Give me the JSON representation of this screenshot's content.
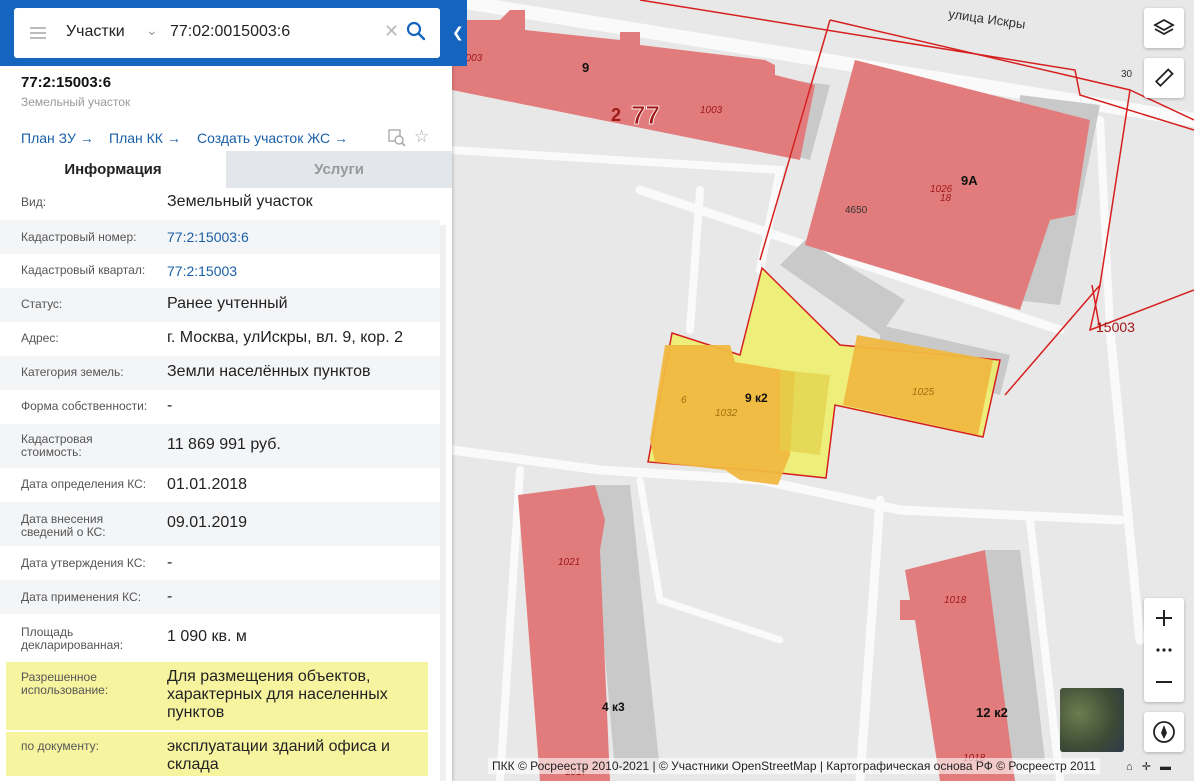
{
  "search": {
    "type_label": "Участки",
    "query": "77:02:0015003:6"
  },
  "object": {
    "id": "77:2:15003:6",
    "type": "Земельный участок",
    "links": [
      "План ЗУ",
      "План КК",
      "Создать участок ЖС"
    ]
  },
  "tabs": [
    "Информация",
    "Услуги"
  ],
  "info": [
    {
      "label": "Вид:",
      "value": "Земельный участок"
    },
    {
      "label": "Кадастровый номер:",
      "value": "77:2:15003:6"
    },
    {
      "label": "Кадастровый квартал:",
      "value": "77:2:15003"
    },
    {
      "label": "Статус:",
      "value": "Ранее учтенный"
    },
    {
      "label": "Адрес:",
      "value": "г. Москва, улИскры, вл. 9, кор. 2"
    },
    {
      "label": "Категория земель:",
      "value": "Земли населённых пунктов"
    },
    {
      "label": "Форма собственности:",
      "value": "-"
    },
    {
      "label": "Кадастровая стоимость:",
      "value": "11 869 991 руб."
    },
    {
      "label": "Дата определения КС:",
      "value": "01.01.2018"
    },
    {
      "label": "Дата внесения сведений о КС:",
      "value": "09.01.2019"
    },
    {
      "label": "Дата утверждения КС:",
      "value": "-"
    },
    {
      "label": "Дата применения КС:",
      "value": "-"
    },
    {
      "label": "Площадь декларированная:",
      "value": "1 090 кв. м"
    },
    {
      "label": "Разрешенное использование:",
      "value": "Для размещения объектов, характерных для населенных пунктов"
    },
    {
      "label": "по документу:",
      "value": "эксплуатации зданий офиса и склада"
    }
  ],
  "map": {
    "street": "улица Искры",
    "labels": {
      "house_9": "9",
      "house_9a": "9А",
      "house_9k2": "9 к2",
      "house_4k3": "4 к3",
      "house_12k2": "12 к2",
      "region": "2",
      "region_code": "77",
      "quarter": "15003",
      "n1003a": "1003",
      "n1003b": "1003",
      "n30": "30",
      "n4650": "4650",
      "n1026": "1026",
      "n18": "18",
      "n6": "6",
      "n1032": "1032",
      "n1025": "1025",
      "n1021": "1021",
      "n1018a": "1018",
      "n1018b": "1018",
      "n1017": "1017"
    },
    "attribution": "ПКК © Росреестр 2010-2021 | © Участники OpenStreetMap | Картографическая основа РФ © Росреестр 2011",
    "colors": {
      "building": "#e27c7c",
      "selected_parcel": "#eeee66",
      "selected_building": "#f0b840",
      "boundary": "#d62020"
    },
    "controls": [
      "layers-icon",
      "ruler-icon",
      "zoom-in-icon",
      "more-icon",
      "zoom-out-icon",
      "compass-icon"
    ]
  }
}
